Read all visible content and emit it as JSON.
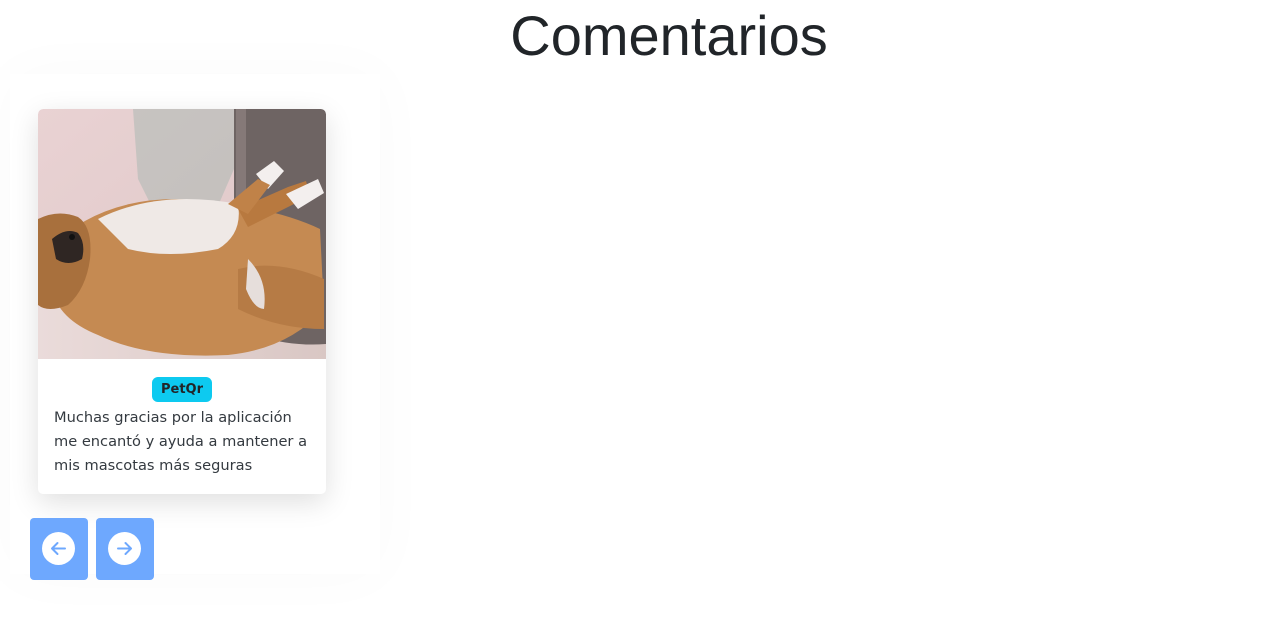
{
  "section": {
    "title": "Comentarios"
  },
  "testimonial": {
    "photo_alt": "dog-photo",
    "badge": "PetQr",
    "comment": "Muchas gracias por la aplicación me encantó y ayuda a mantener a mis mascotas más seguras"
  },
  "controls": {
    "prev_icon": "arrow-left-icon",
    "next_icon": "arrow-right-icon"
  },
  "colors": {
    "badge_bg": "#0dcaf0",
    "nav_bg": "#6ea8fe",
    "text": "#212529"
  }
}
